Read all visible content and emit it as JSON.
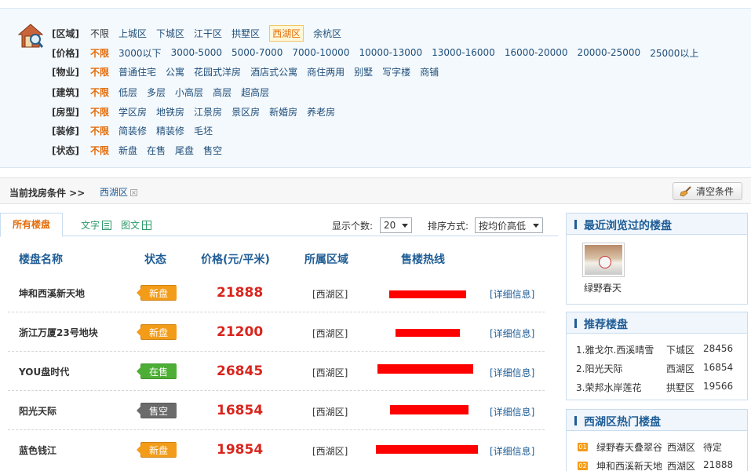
{
  "filters": [
    {
      "label": "[区域]",
      "options": [
        "不限",
        "上城区",
        "下城区",
        "江干区",
        "拱墅区",
        "西湖区",
        "余杭区"
      ],
      "selected": 5
    },
    {
      "label": "[价格]",
      "options": [
        "不限",
        "3000以下",
        "3000-5000",
        "5000-7000",
        "7000-10000",
        "10000-13000",
        "13000-16000",
        "16000-20000",
        "20000-25000",
        "25000以上"
      ],
      "selected": 0
    },
    {
      "label": "[物业]",
      "options": [
        "不限",
        "普通住宅",
        "公寓",
        "花园式洋房",
        "酒店式公寓",
        "商住两用",
        "别墅",
        "写字楼",
        "商铺"
      ],
      "selected": 0
    },
    {
      "label": "[建筑]",
      "options": [
        "不限",
        "低层",
        "多层",
        "小高层",
        "高层",
        "超高层"
      ],
      "selected": 0
    },
    {
      "label": "[房型]",
      "options": [
        "不限",
        "学区房",
        "地铁房",
        "江景房",
        "景区房",
        "新婚房",
        "养老房"
      ],
      "selected": 0
    },
    {
      "label": "[装修]",
      "options": [
        "不限",
        "简装修",
        "精装修",
        "毛坯"
      ],
      "selected": 0
    },
    {
      "label": "[状态]",
      "options": [
        "不限",
        "新盘",
        "在售",
        "尾盘",
        "售空"
      ],
      "selected": 0
    }
  ],
  "condition": {
    "label": "当前找房条件 >>",
    "tag": "西湖区",
    "clear_label": "清空条件"
  },
  "tabs": {
    "all": "所有楼盘",
    "text_view": "文字",
    "image_view": "图文"
  },
  "controls": {
    "count_label": "显示个数:",
    "count_value": "20",
    "sort_label": "排序方式:",
    "sort_value": "按均价高低"
  },
  "table": {
    "headers": [
      "楼盘名称",
      "状态",
      "价格(元/平米)",
      "所属区域",
      "售楼热线"
    ],
    "detail_label": "[详细信息]",
    "rows": [
      {
        "name": "坤和西溪新天地",
        "status": "新盘",
        "status_color": "#f39c19",
        "price": "21888",
        "area": "[西湖区]"
      },
      {
        "name": "浙江万厦23号地块",
        "status": "新盘",
        "status_color": "#f39c19",
        "price": "21200",
        "area": "[西湖区]"
      },
      {
        "name": "YOU盘时代",
        "status": "在售",
        "status_color": "#4dae36",
        "price": "26845",
        "area": "[西湖区]"
      },
      {
        "name": "阳光天际",
        "status": "售空",
        "status_color": "#6b6b6b",
        "price": "16854",
        "area": "[西湖区]"
      },
      {
        "name": "蓝色钱江",
        "status": "新盘",
        "status_color": "#f39c19",
        "price": "19854",
        "area": "[西湖区]"
      }
    ]
  },
  "sidebar": {
    "recent": {
      "title": "最近浏览过的楼盘",
      "caption": "绿野春天"
    },
    "recommend": {
      "title": "推荐楼盘",
      "items": [
        {
          "name": "1.雅戈尔.西溪晴雪",
          "area": "下城区",
          "price": "28456"
        },
        {
          "name": "2.阳光天际",
          "area": "西湖区",
          "price": "16854"
        },
        {
          "name": "3.荣邦水岸莲花",
          "area": "拱墅区",
          "price": "19566"
        }
      ]
    },
    "hot": {
      "title": "西湖区热门楼盘",
      "items": [
        {
          "num": "01",
          "name": "绿野春天叠翠谷",
          "area": "西湖区",
          "value": "待定"
        },
        {
          "num": "02",
          "name": "坤和西溪新天地",
          "area": "西湖区",
          "value": "21888"
        }
      ]
    }
  },
  "colors": {
    "accent_orange": "#e46c0a",
    "link_blue": "#1f5d96",
    "price_red": "#d9251d",
    "status_new": "#f39c19",
    "status_onsale": "#4dae36",
    "status_soldout": "#6b6b6b"
  },
  "icons": {
    "filter": "house-search-icon",
    "clear": "broom-icon",
    "text_view": "list-view-icon",
    "image_view": "grid-view-icon"
  }
}
